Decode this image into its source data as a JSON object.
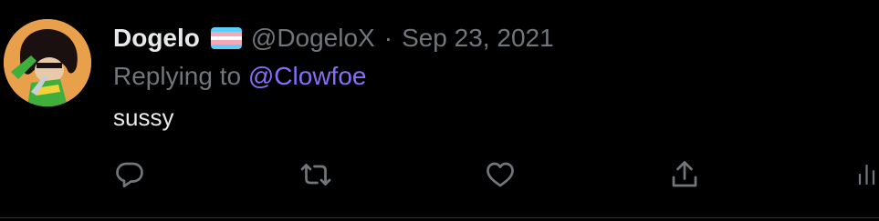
{
  "tweet": {
    "display_name": "Dogelo",
    "badge_icon": "transgender-flag-icon",
    "handle": "@DogeloX",
    "separator": "·",
    "date": "Sep 23, 2021",
    "replying_prefix": "Replying to",
    "replying_to": "@Clowfoe",
    "text": "sussy"
  },
  "actions": [
    {
      "name": "reply",
      "icon": "reply-icon"
    },
    {
      "name": "retweet",
      "icon": "retweet-icon"
    },
    {
      "name": "like",
      "icon": "heart-icon"
    },
    {
      "name": "share",
      "icon": "share-icon"
    },
    {
      "name": "analytics",
      "icon": "analytics-icon"
    }
  ],
  "colors": {
    "background": "#000000",
    "primary_text": "#e7e9ea",
    "secondary_text": "#71767b",
    "mention": "#8a6cf7",
    "flag_blue": "#5bcefa",
    "flag_pink": "#f5a9b8",
    "flag_white": "#ffffff"
  }
}
